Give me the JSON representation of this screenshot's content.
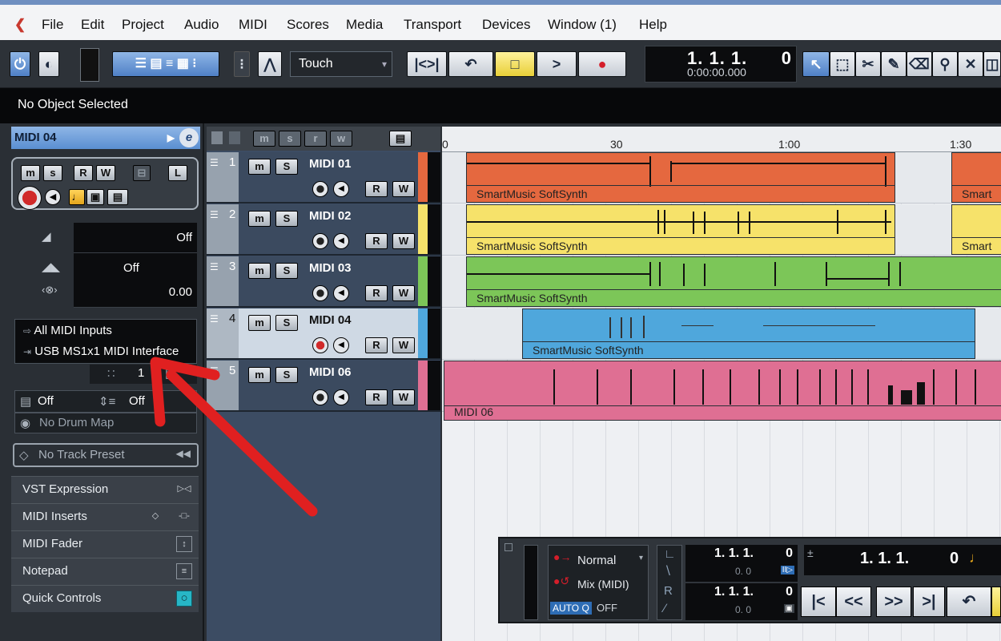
{
  "menu": [
    "File",
    "Edit",
    "Project",
    "Audio",
    "MIDI",
    "Scores",
    "Media",
    "Transport",
    "Devices",
    "Window (1)",
    "Help"
  ],
  "toolbar": {
    "automation_mode": "Touch",
    "position_main": "1. 1. 1.",
    "position_sub": "0",
    "position_time": "0:00:00.000",
    "tools": [
      "object-select",
      "range-select",
      "split",
      "glue",
      "erase",
      "zoom",
      "mute",
      "time-warp"
    ]
  },
  "info_line": "No Object Selected",
  "inspector": {
    "track_name": "MIDI 04",
    "edit_button": "e",
    "mini_buttons": [
      "m",
      "s",
      "R",
      "W",
      "L"
    ],
    "volume": "Off",
    "pan": "Off",
    "delay": "0.00",
    "input": "All MIDI Inputs",
    "output": "USB MS1x1 MIDI Interface",
    "channel": "1",
    "bank": "Off",
    "program": "Off",
    "drum_map": "No Drum Map",
    "track_preset": "No Track Preset",
    "sections": [
      "VST Expression",
      "MIDI Inserts",
      "MIDI Fader",
      "Notepad",
      "Quick Controls"
    ]
  },
  "tracklist_header": [
    "m",
    "s",
    "r",
    "w"
  ],
  "tracks": [
    {
      "num": "1",
      "name": "MIDI 01",
      "color": "#e5683f",
      "m": "m",
      "s": "S",
      "r": "R",
      "w": "W"
    },
    {
      "num": "2",
      "name": "MIDI 02",
      "color": "#f6e26a",
      "m": "m",
      "s": "S",
      "r": "R",
      "w": "W"
    },
    {
      "num": "3",
      "name": "MIDI 03",
      "color": "#7cc658",
      "m": "m",
      "s": "S",
      "r": "R",
      "w": "W"
    },
    {
      "num": "4",
      "name": "MIDI 04",
      "color": "#4fa7dc",
      "m": "m",
      "s": "S",
      "r": "R",
      "w": "W"
    },
    {
      "num": "5",
      "name": "MIDI 06",
      "color": "#df6f93",
      "m": "m",
      "s": "S",
      "r": "R",
      "w": "W"
    }
  ],
  "ruler": [
    "0",
    "30",
    "1:00",
    "1:30"
  ],
  "parts": [
    {
      "label": "SmartMusic SoftSynth"
    },
    {
      "label": "Smart"
    },
    {
      "label": "SmartMusic SoftSynth"
    },
    {
      "label": "Smart"
    },
    {
      "label": "SmartMusic SoftSynth"
    },
    {
      "label": "SmartMusic SoftSynth"
    },
    {
      "label": "MIDI 06"
    }
  ],
  "transport": {
    "quantize_mode": "Normal",
    "record_mode": "Mix (MIDI)",
    "auto_q": "AUTO Q",
    "auto_q_state": "OFF",
    "left_locator": "1. 1. 1.",
    "left_locator_sub": "0",
    "left_locator_ticks": "0. 0",
    "right_locator": "1. 1. 1.",
    "right_locator_sub": "0",
    "right_locator_ticks": "0. 0",
    "position": "1. 1. 1.",
    "position_sub": "0"
  }
}
